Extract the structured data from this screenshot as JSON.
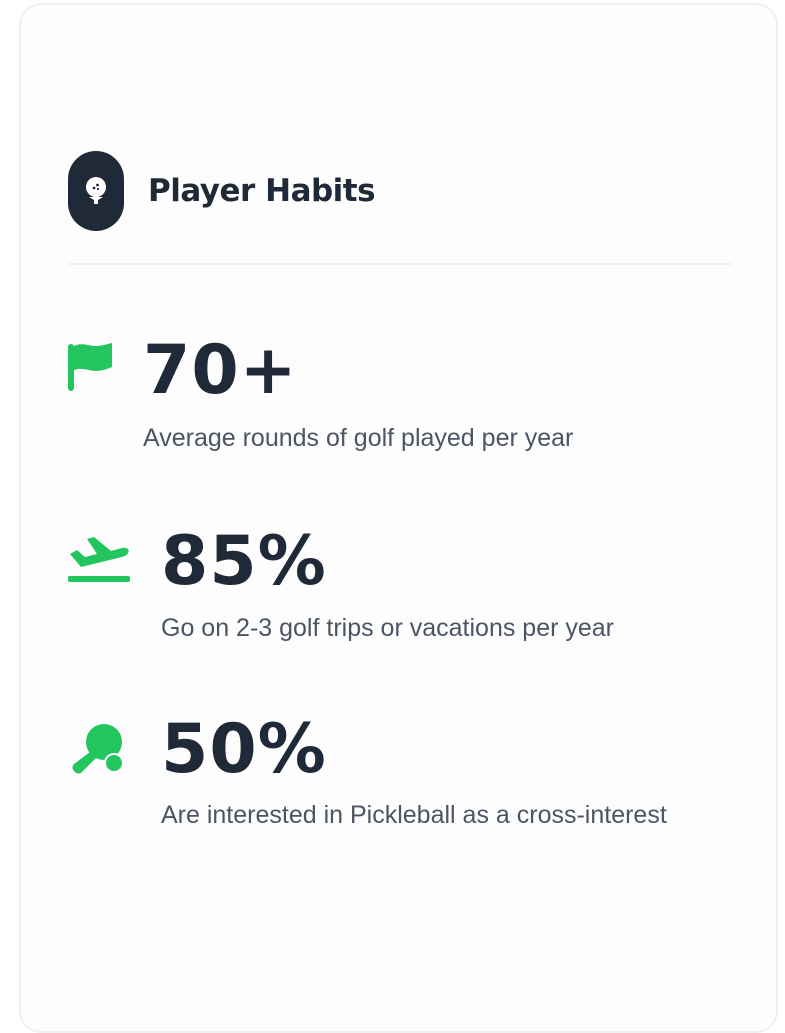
{
  "header": {
    "title": "Player Habits",
    "icon": "golf-ball-tee-icon"
  },
  "colors": {
    "accent": "#22c55e",
    "dark": "#1f2937",
    "muted": "#4b5563"
  },
  "stats": [
    {
      "icon": "flag-icon",
      "value": "70+",
      "description": "Average rounds of golf played per year"
    },
    {
      "icon": "plane-departure-icon",
      "value": "85%",
      "description": "Go on 2-3 golf trips or vacations per year"
    },
    {
      "icon": "table-tennis-paddle-icon",
      "value": "50%",
      "description": "Are interested in Pickleball as a cross-interest"
    }
  ]
}
